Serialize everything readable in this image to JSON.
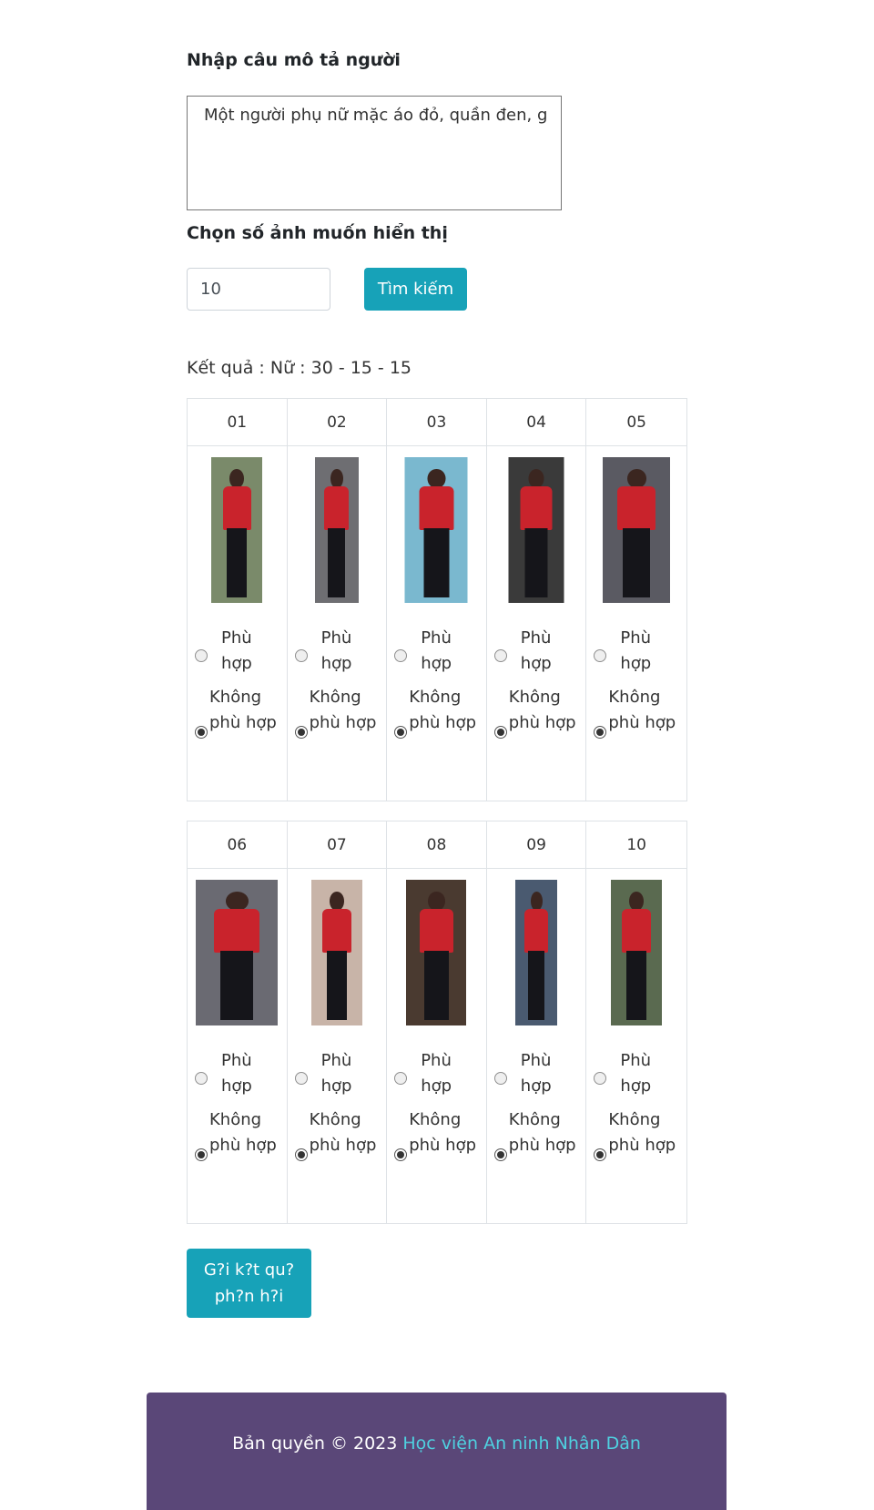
{
  "form": {
    "desc_label": "Nhập câu mô tả người",
    "desc_value": "Một người phụ nữ mặc áo đỏ, quần đen, g",
    "count_label": "Chọn số ảnh muốn hiển thị",
    "count_value": "10",
    "search_button": "Tìm kiếm"
  },
  "result": {
    "text": "Kết quả : Nữ : 30 - 15 - 15"
  },
  "options": {
    "match_label": "Phù hợp",
    "nomatch_label": "Không phù hợp"
  },
  "images": [
    {
      "id": "01",
      "selected": "nomatch",
      "aspect": 0.35
    },
    {
      "id": "02",
      "selected": "nomatch",
      "aspect": 0.3
    },
    {
      "id": "03",
      "selected": "nomatch",
      "aspect": 0.43
    },
    {
      "id": "04",
      "selected": "nomatch",
      "aspect": 0.38
    },
    {
      "id": "05",
      "selected": "nomatch",
      "aspect": 0.46
    },
    {
      "id": "06",
      "selected": "nomatch",
      "aspect": 0.56
    },
    {
      "id": "07",
      "selected": "nomatch",
      "aspect": 0.35
    },
    {
      "id": "08",
      "selected": "nomatch",
      "aspect": 0.41
    },
    {
      "id": "09",
      "selected": "nomatch",
      "aspect": 0.29
    },
    {
      "id": "10",
      "selected": "nomatch",
      "aspect": 0.35
    }
  ],
  "submit": {
    "label": "G?i k?t qu? ph?n h?i"
  },
  "footer": {
    "prefix": "Bản quyền © 2023 ",
    "link": "Học viện An ninh Nhân Dân"
  },
  "colors": {
    "accent": "#17a2b8",
    "footer_bg": "#5a4778",
    "footer_link": "#4fd1e0"
  }
}
